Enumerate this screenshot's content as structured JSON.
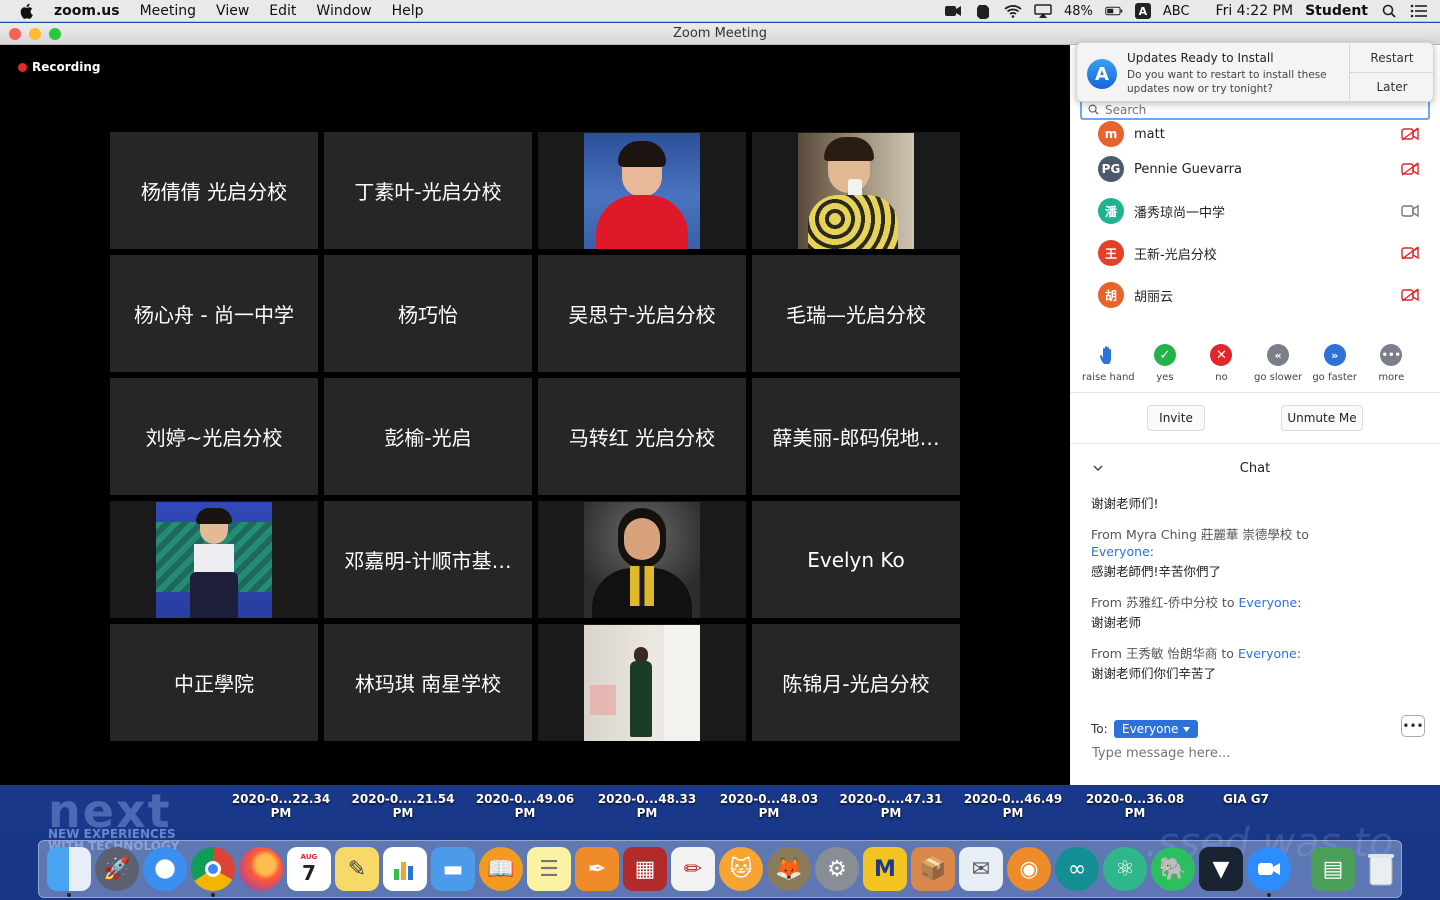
{
  "menubar": {
    "items": [
      "zoom.us",
      "Meeting",
      "View",
      "Edit",
      "Window",
      "Help"
    ],
    "battery": "48%",
    "input_source": "ABC",
    "clock": "Fri 4:22 PM",
    "user": "Student"
  },
  "window": {
    "title": "Zoom Meeting"
  },
  "recording": {
    "label": "Recording"
  },
  "gallery": {
    "tiles": [
      {
        "name": "杨倩倩 光启分校"
      },
      {
        "name": "丁素叶-光启分校"
      },
      {
        "name": ""
      },
      {
        "name": ""
      },
      {
        "name": "杨心舟 - 尚一中学"
      },
      {
        "name": "杨巧怡"
      },
      {
        "name": "吴思宁-光启分校"
      },
      {
        "name": "毛瑞—光启分校"
      },
      {
        "name": "刘婷~光启分校"
      },
      {
        "name": "彭榆-光启"
      },
      {
        "name": "马转红  光启分校"
      },
      {
        "name": "薛美丽-郎码倪地…"
      },
      {
        "name": ""
      },
      {
        "name": "邓嘉明-计顺市基…"
      },
      {
        "name": ""
      },
      {
        "name": "Evelyn Ko"
      },
      {
        "name": "中正學院"
      },
      {
        "name": "林玛琪 南星学校"
      },
      {
        "name": ""
      },
      {
        "name": "陈锦月-光启分校"
      }
    ]
  },
  "notification": {
    "title": "Updates Ready to Install",
    "body": "Do you want to restart to install these updates now or try tonight?",
    "restart": "Restart",
    "later": "Later"
  },
  "search": {
    "placeholder": "Search"
  },
  "participants": [
    {
      "initials": "m",
      "name": "matt",
      "color": "#e8632b"
    },
    {
      "initials": "PG",
      "name": "Pennie Guevarra",
      "color": "#4b5a6e"
    },
    {
      "initials": "潘",
      "name": "潘秀琼尚一中学",
      "color": "#1fb394"
    },
    {
      "initials": "王",
      "name": "王新-光启分校",
      "color": "#e3412b"
    },
    {
      "initials": "胡",
      "name": "胡丽云",
      "color": "#e8632b"
    }
  ],
  "reactions": [
    {
      "label": "raise hand"
    },
    {
      "label": "yes"
    },
    {
      "label": "no"
    },
    {
      "label": "go slower"
    },
    {
      "label": "go faster"
    },
    {
      "label": "more"
    }
  ],
  "actions": {
    "invite": "Invite",
    "unmute": "Unmute Me"
  },
  "chat": {
    "title": "Chat",
    "first_text": "谢谢老师们!",
    "messages": [
      {
        "from": "From Myra Ching 莊麗華 崇德學校 to",
        "to": "Everyone",
        "text": "感謝老師們!辛苦你們了"
      },
      {
        "from": "From 苏雅红-侨中分校 to",
        "to": "Everyone",
        "text": "谢谢老师"
      },
      {
        "from": "From 王秀敏 怡朗华商 to",
        "to": "Everyone",
        "text": "谢谢老师们你们辛苦了"
      }
    ],
    "to_label": "To:",
    "recipient": "Everyone",
    "input_placeholder": "Type message here..."
  },
  "desktop": {
    "screenshot_labels": [
      "2020-0...22.34 PM",
      "2020-0....21.54 PM",
      "2020-0...49.06 PM",
      "2020-0...48.33 PM",
      "2020-0...48.03 PM",
      "2020-0....47.31 PM",
      "2020-0...46.49 PM",
      "2020-0...36.08 PM",
      "GIA G7"
    ]
  }
}
